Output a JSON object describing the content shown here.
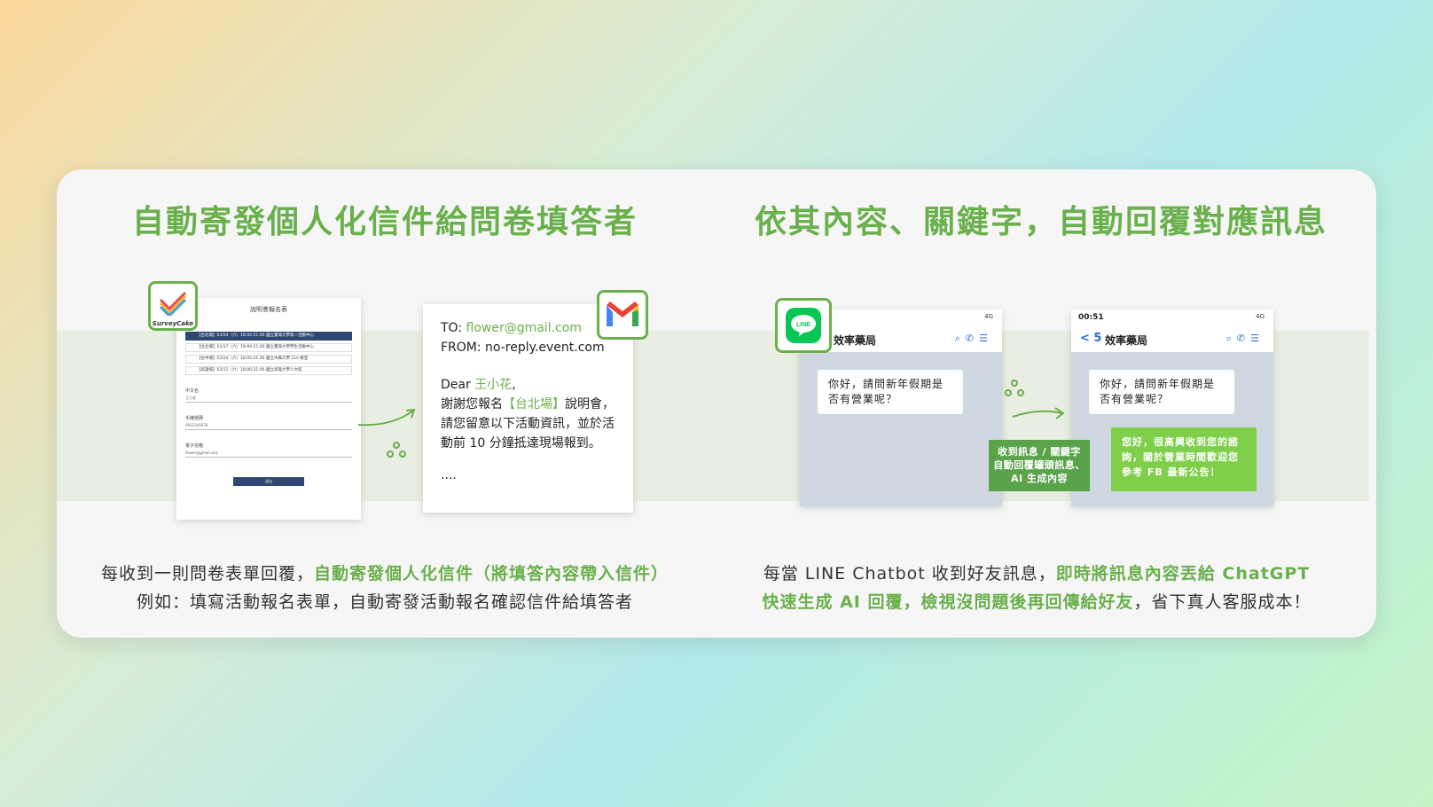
{
  "left": {
    "title": "自動寄發個人化信件給問卷填答者",
    "desc_1a": "每收到一則問卷表單回覆，",
    "desc_1b": "自動寄發個人化信件（將填答內容帶入信件）",
    "desc_2": "例如：填寫活動報名表單，自動寄發活動報名確認信件給填答者"
  },
  "right": {
    "title": "依其內容、關鍵字，自動回覆對應訊息",
    "desc_1a": "每當 LINE Chatbot 收到好友訊息，",
    "desc_1b": "即時將訊息內容丟給 ChatGPT",
    "desc_2a": "快速生成 AI 回覆，檢視沒問題後再回傳給好友",
    "desc_2b": "，省下真人客服成本！"
  },
  "survey": {
    "logo_text": "SurveyCake",
    "form_title": "說明會報名表",
    "question": "場次",
    "options": [
      "【台北場】03/04（六）18:00-21:00 國立臺灣大學第一活動中心",
      "【台北場】03/17（六）18:00-21:00 國立臺灣大學學生活動中心",
      "【台中場】03/24（六）18:00-21:00 國立中興大學 110 教室",
      "【高雄場】03/31（六）18:00-21:00 國立高雄大學人文館"
    ],
    "name_label": "中文名",
    "name_value": "王小花",
    "phone_label": "手機號碼",
    "phone_value": "0912345678",
    "email_label": "電子信箱",
    "email_value": "flower@gmail.com",
    "submit": "送出"
  },
  "email": {
    "to_label": "TO: ",
    "to_value": "flower@gmail.com",
    "from": "FROM: no-reply.event.com",
    "dear": "Dear ",
    "name": "王小花",
    "comma": ",",
    "line1a": "謝謝您報名",
    "venue": "【台北場】",
    "line1b": "說明會，",
    "line2": "請您留意以下活動資訊，並於活",
    "line3": "動前 10 分鐘抵達現場報到。",
    "ellipsis": "...."
  },
  "phone1": {
    "time": "",
    "status": "4G",
    "name": "效率藥局",
    "message": "你好，請問新年假期是否有營業呢？"
  },
  "phone2": {
    "time": "00:51",
    "status": "4G",
    "back": "< 5",
    "name": "效率藥局",
    "message": "你好，請問新年假期是否有營業呢？",
    "reply": "您好，很高興收到您的諮詢，關於營業時間歡迎您參考 FB 最新公告！"
  },
  "middle_tag": {
    "line1": "收到訊息 / 關鍵字",
    "line2": "自動回覆罐頭訊息、",
    "line3": "AI 生成內容"
  },
  "colors": {
    "accent": "#6ab04c",
    "form_dark": "#2f4773",
    "reply_green": "#7fcf4a"
  }
}
